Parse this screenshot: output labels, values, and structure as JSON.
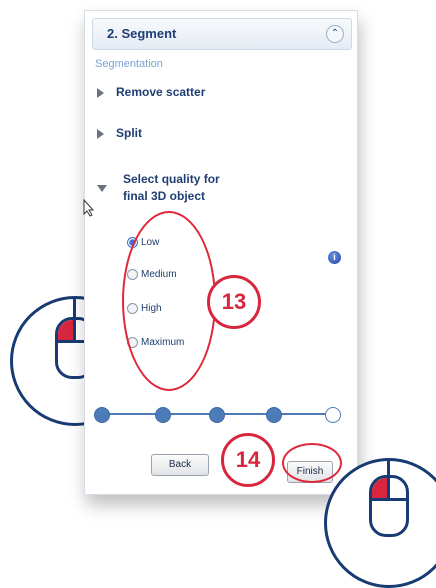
{
  "panel": {
    "title": "2. Segment",
    "collapse_icon": "double-chevron-up-icon",
    "section_label": "Segmentation",
    "items": [
      {
        "label": "Remove scatter",
        "state": "collapsed"
      },
      {
        "label": "Split",
        "state": "collapsed"
      },
      {
        "label": "Select quality for final 3D object",
        "state": "expanded"
      }
    ],
    "quality_options": [
      {
        "label": "Low",
        "selected": true
      },
      {
        "label": "Medium",
        "selected": false
      },
      {
        "label": "High",
        "selected": false
      },
      {
        "label": "Maximum",
        "selected": false
      }
    ],
    "info_icon": "info-icon",
    "steps": {
      "total": 5,
      "current": 5
    },
    "back_label": "Back",
    "finish_label": "Finish"
  },
  "annotations": {
    "badge_13": "13",
    "badge_14": "14",
    "accent_color": "#d7263d",
    "outline_color": "#173b72"
  }
}
